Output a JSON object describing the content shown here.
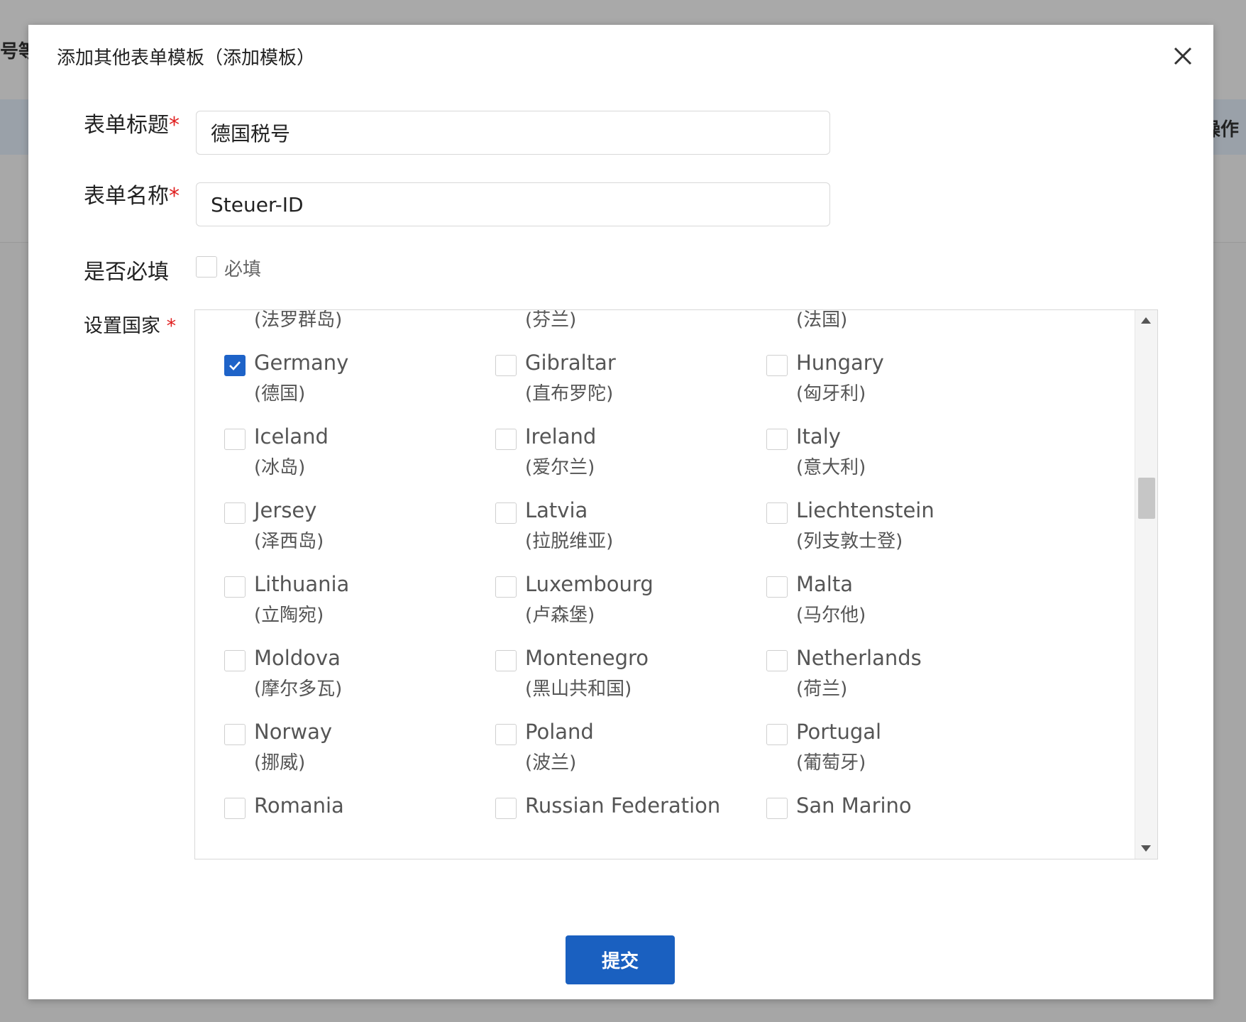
{
  "background": {
    "left_text": "号等(",
    "right_text": "操作"
  },
  "dialog": {
    "title": "添加其他表单模板（添加模板）",
    "close_icon": "close-icon"
  },
  "form": {
    "title_label": "表单标题",
    "title_value": "德国税号",
    "name_label": "表单名称",
    "name_value": "Steuer-ID",
    "required_label": "是否必填",
    "required_checkbox_label": "必填",
    "required_checked": false,
    "country_label": "设置国家",
    "required_mark": "*"
  },
  "countries": {
    "partial_top": [
      "(法罗群岛)",
      "(芬兰)",
      "(法国)"
    ],
    "rows": [
      [
        {
          "en": "Germany",
          "cn": "(德国)",
          "checked": true
        },
        {
          "en": "Gibraltar",
          "cn": "(直布罗陀)",
          "checked": false
        },
        {
          "en": "Hungary",
          "cn": "(匈牙利)",
          "checked": false
        }
      ],
      [
        {
          "en": "Iceland",
          "cn": "(冰岛)",
          "checked": false
        },
        {
          "en": "Ireland",
          "cn": "(爱尔兰)",
          "checked": false
        },
        {
          "en": "Italy",
          "cn": "(意大利)",
          "checked": false
        }
      ],
      [
        {
          "en": "Jersey",
          "cn": "(泽西岛)",
          "checked": false
        },
        {
          "en": "Latvia",
          "cn": "(拉脱维亚)",
          "checked": false
        },
        {
          "en": "Liechtenstein",
          "cn": "(列支敦士登)",
          "checked": false
        }
      ],
      [
        {
          "en": "Lithuania",
          "cn": "(立陶宛)",
          "checked": false
        },
        {
          "en": "Luxembourg",
          "cn": "(卢森堡)",
          "checked": false
        },
        {
          "en": "Malta",
          "cn": "(马尔他)",
          "checked": false
        }
      ],
      [
        {
          "en": "Moldova",
          "cn": "(摩尔多瓦)",
          "checked": false
        },
        {
          "en": "Montenegro",
          "cn": "(黑山共和国)",
          "checked": false
        },
        {
          "en": "Netherlands",
          "cn": "(荷兰)",
          "checked": false
        }
      ],
      [
        {
          "en": "Norway",
          "cn": "(挪威)",
          "checked": false
        },
        {
          "en": "Poland",
          "cn": "(波兰)",
          "checked": false
        },
        {
          "en": "Portugal",
          "cn": "(葡萄牙)",
          "checked": false
        }
      ]
    ],
    "partial_bottom": [
      "Romania",
      "Russian Federation",
      "San Marino"
    ]
  },
  "submit_label": "提交",
  "colors": {
    "accent": "#1a60c0",
    "required": "#e02020"
  }
}
